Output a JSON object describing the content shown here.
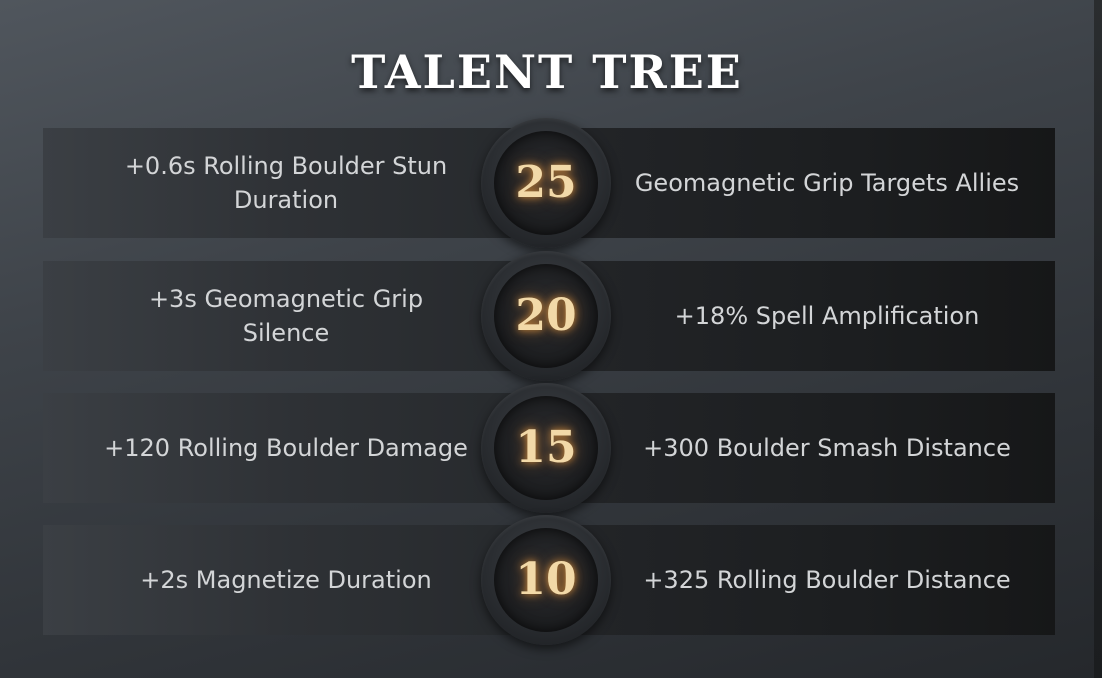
{
  "title": "TALENT TREE",
  "colors": {
    "level_number": "#f2d9a8",
    "level_glow": "#ffaa46",
    "talent_text": "#d3d5d7",
    "title_text": "#ffffff"
  },
  "rows": [
    {
      "level": "25",
      "left": "+0.6s Rolling Boulder Stun Duration",
      "right": "Geomagnetic Grip Targets Allies"
    },
    {
      "level": "20",
      "left": "+3s Geomagnetic Grip Silence",
      "right": "+18% Spell Amplification"
    },
    {
      "level": "15",
      "left": "+120 Rolling Boulder Damage",
      "right": "+300 Boulder Smash Distance"
    },
    {
      "level": "10",
      "left": "+2s Magnetize Duration",
      "right": "+325 Rolling Boulder Distance"
    }
  ]
}
